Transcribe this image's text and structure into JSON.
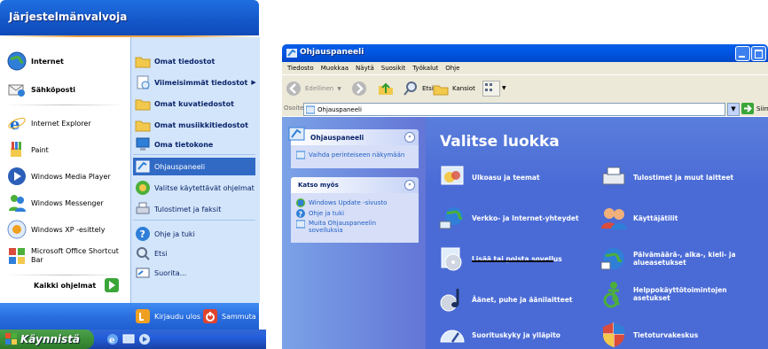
{
  "start_menu": {
    "header": "Järjestelmänvalvoja",
    "pinned": [
      {
        "name": "internet",
        "label": "Internet"
      },
      {
        "name": "email",
        "label": "Sähköposti"
      }
    ],
    "recent": [
      {
        "label": "Internet Explorer"
      },
      {
        "label": "Paint"
      },
      {
        "label": "Windows Media Player"
      },
      {
        "label": "Windows Messenger"
      },
      {
        "label": "Windows XP -esittely"
      },
      {
        "label": "Microsoft Office Shortcut Bar"
      }
    ],
    "all_programs": "Kaikki ohjelmat",
    "right": [
      {
        "label": "Omat tiedostot"
      },
      {
        "label": "Viimeisimmät tiedostot"
      },
      {
        "label": "Omat kuvatiedostot"
      },
      {
        "label": "Omat musiikkitiedostot"
      },
      {
        "label": "Oma tietokone"
      },
      {
        "label": "Ohjauspaneeli"
      },
      {
        "label": "Valitse käytettävät ohjelmat"
      },
      {
        "label": "Tulostimet ja faksit"
      },
      {
        "label": "Ohje ja tuki"
      },
      {
        "label": "Etsi"
      },
      {
        "label": "Suorita..."
      }
    ],
    "logoff": "Kirjaudu ulos",
    "shutdown": "Sammuta",
    "start_button": "Käynnistä"
  },
  "control_panel": {
    "title": "Ohjauspaneeli",
    "menu": [
      "Tiedosto",
      "Muokkaa",
      "Näytä",
      "Suosikit",
      "Työkalut",
      "Ohje"
    ],
    "toolbar": {
      "back": "Edellinen",
      "search": "Etsi",
      "folders": "Kansiot"
    },
    "address": {
      "label": "Osoite",
      "value": "Ohjauspaneeli",
      "go": "Siirry"
    },
    "sidebar": {
      "panel_title": "Ohjauspaneeli",
      "switch_view": "Vaihda perinteiseen näkymään",
      "see_also_title": "Katso myös",
      "links": [
        "Windows Update -sivusto",
        "Ohje ja tuki",
        "Muita Ohjauspaneelin sovelluksia"
      ]
    },
    "heading": "Valitse luokka",
    "categories": [
      {
        "label": "Ulkoasu ja teemat"
      },
      {
        "label": "Tulostimet ja muut laitteet"
      },
      {
        "label": "Verkko- ja Internet-yhteydet"
      },
      {
        "label": "Käyttäjätilit"
      },
      {
        "label": "Lisää tai poista sovellus"
      },
      {
        "label": "Päivämäärä-, aika-, kieli- ja alueasetukset"
      },
      {
        "label": "Äänet, puhe ja äänilaitteet"
      },
      {
        "label": "Helppokäyttötoimintojen asetukset"
      },
      {
        "label": "Suorituskyky ja ylläpito"
      },
      {
        "label": "Tietoturvakeskus"
      }
    ]
  }
}
